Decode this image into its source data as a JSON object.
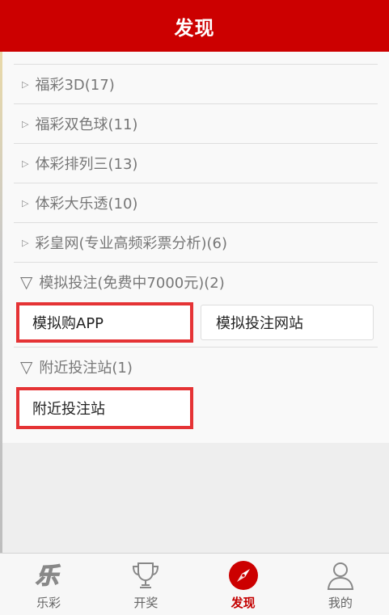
{
  "header": {
    "title": "发现"
  },
  "list": {
    "items": [
      {
        "label": "福彩3D(17)"
      },
      {
        "label": "福彩双色球(11)"
      },
      {
        "label": "体彩排列三(13)"
      },
      {
        "label": "体彩大乐透(10)"
      },
      {
        "label": "彩皇网(专业高频彩票分析)(6)"
      }
    ],
    "sim": {
      "label": "模拟投注(免费中7000元)(2)",
      "options": [
        "模拟购APP",
        "模拟投注网站"
      ]
    },
    "nearby": {
      "label": "附近投注站(1)",
      "options": [
        "附近投注站"
      ]
    }
  },
  "tabbar": {
    "tabs": [
      {
        "label": "乐彩",
        "icon": "lecai-icon"
      },
      {
        "label": "开奖",
        "icon": "trophy-icon"
      },
      {
        "label": "发现",
        "icon": "compass-icon"
      },
      {
        "label": "我的",
        "icon": "person-icon"
      }
    ],
    "active_index": 2,
    "active_color": "#c40000",
    "accent_color": "#cc0000"
  }
}
